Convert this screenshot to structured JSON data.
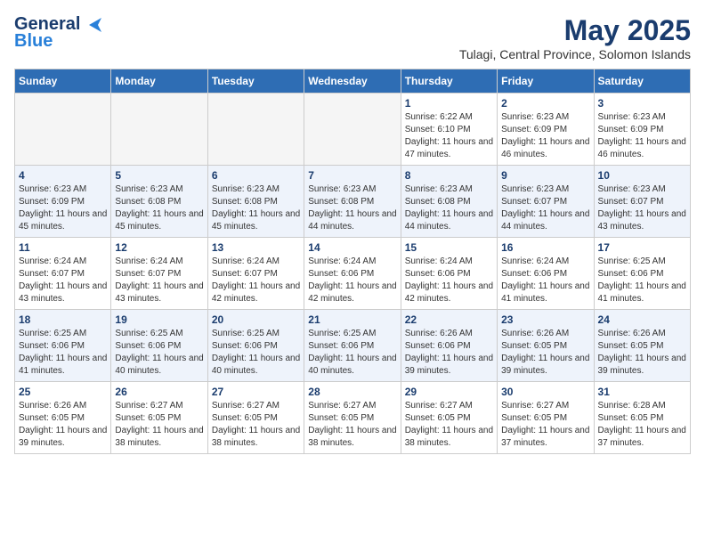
{
  "logo": {
    "line1": "General",
    "line2": "Blue"
  },
  "title": {
    "month_year": "May 2025",
    "location": "Tulagi, Central Province, Solomon Islands"
  },
  "days_of_week": [
    "Sunday",
    "Monday",
    "Tuesday",
    "Wednesday",
    "Thursday",
    "Friday",
    "Saturday"
  ],
  "weeks": [
    [
      {
        "day": "",
        "empty": true
      },
      {
        "day": "",
        "empty": true
      },
      {
        "day": "",
        "empty": true
      },
      {
        "day": "",
        "empty": true
      },
      {
        "day": "1",
        "sunrise": "6:22 AM",
        "sunset": "6:10 PM",
        "daylight": "11 hours and 47 minutes."
      },
      {
        "day": "2",
        "sunrise": "6:23 AM",
        "sunset": "6:09 PM",
        "daylight": "11 hours and 46 minutes."
      },
      {
        "day": "3",
        "sunrise": "6:23 AM",
        "sunset": "6:09 PM",
        "daylight": "11 hours and 46 minutes."
      }
    ],
    [
      {
        "day": "4",
        "sunrise": "6:23 AM",
        "sunset": "6:09 PM",
        "daylight": "11 hours and 45 minutes."
      },
      {
        "day": "5",
        "sunrise": "6:23 AM",
        "sunset": "6:08 PM",
        "daylight": "11 hours and 45 minutes."
      },
      {
        "day": "6",
        "sunrise": "6:23 AM",
        "sunset": "6:08 PM",
        "daylight": "11 hours and 45 minutes."
      },
      {
        "day": "7",
        "sunrise": "6:23 AM",
        "sunset": "6:08 PM",
        "daylight": "11 hours and 44 minutes."
      },
      {
        "day": "8",
        "sunrise": "6:23 AM",
        "sunset": "6:08 PM",
        "daylight": "11 hours and 44 minutes."
      },
      {
        "day": "9",
        "sunrise": "6:23 AM",
        "sunset": "6:07 PM",
        "daylight": "11 hours and 44 minutes."
      },
      {
        "day": "10",
        "sunrise": "6:23 AM",
        "sunset": "6:07 PM",
        "daylight": "11 hours and 43 minutes."
      }
    ],
    [
      {
        "day": "11",
        "sunrise": "6:24 AM",
        "sunset": "6:07 PM",
        "daylight": "11 hours and 43 minutes."
      },
      {
        "day": "12",
        "sunrise": "6:24 AM",
        "sunset": "6:07 PM",
        "daylight": "11 hours and 43 minutes."
      },
      {
        "day": "13",
        "sunrise": "6:24 AM",
        "sunset": "6:07 PM",
        "daylight": "11 hours and 42 minutes."
      },
      {
        "day": "14",
        "sunrise": "6:24 AM",
        "sunset": "6:06 PM",
        "daylight": "11 hours and 42 minutes."
      },
      {
        "day": "15",
        "sunrise": "6:24 AM",
        "sunset": "6:06 PM",
        "daylight": "11 hours and 42 minutes."
      },
      {
        "day": "16",
        "sunrise": "6:24 AM",
        "sunset": "6:06 PM",
        "daylight": "11 hours and 41 minutes."
      },
      {
        "day": "17",
        "sunrise": "6:25 AM",
        "sunset": "6:06 PM",
        "daylight": "11 hours and 41 minutes."
      }
    ],
    [
      {
        "day": "18",
        "sunrise": "6:25 AM",
        "sunset": "6:06 PM",
        "daylight": "11 hours and 41 minutes."
      },
      {
        "day": "19",
        "sunrise": "6:25 AM",
        "sunset": "6:06 PM",
        "daylight": "11 hours and 40 minutes."
      },
      {
        "day": "20",
        "sunrise": "6:25 AM",
        "sunset": "6:06 PM",
        "daylight": "11 hours and 40 minutes."
      },
      {
        "day": "21",
        "sunrise": "6:25 AM",
        "sunset": "6:06 PM",
        "daylight": "11 hours and 40 minutes."
      },
      {
        "day": "22",
        "sunrise": "6:26 AM",
        "sunset": "6:06 PM",
        "daylight": "11 hours and 39 minutes."
      },
      {
        "day": "23",
        "sunrise": "6:26 AM",
        "sunset": "6:05 PM",
        "daylight": "11 hours and 39 minutes."
      },
      {
        "day": "24",
        "sunrise": "6:26 AM",
        "sunset": "6:05 PM",
        "daylight": "11 hours and 39 minutes."
      }
    ],
    [
      {
        "day": "25",
        "sunrise": "6:26 AM",
        "sunset": "6:05 PM",
        "daylight": "11 hours and 39 minutes."
      },
      {
        "day": "26",
        "sunrise": "6:27 AM",
        "sunset": "6:05 PM",
        "daylight": "11 hours and 38 minutes."
      },
      {
        "day": "27",
        "sunrise": "6:27 AM",
        "sunset": "6:05 PM",
        "daylight": "11 hours and 38 minutes."
      },
      {
        "day": "28",
        "sunrise": "6:27 AM",
        "sunset": "6:05 PM",
        "daylight": "11 hours and 38 minutes."
      },
      {
        "day": "29",
        "sunrise": "6:27 AM",
        "sunset": "6:05 PM",
        "daylight": "11 hours and 38 minutes."
      },
      {
        "day": "30",
        "sunrise": "6:27 AM",
        "sunset": "6:05 PM",
        "daylight": "11 hours and 37 minutes."
      },
      {
        "day": "31",
        "sunrise": "6:28 AM",
        "sunset": "6:05 PM",
        "daylight": "11 hours and 37 minutes."
      }
    ]
  ]
}
